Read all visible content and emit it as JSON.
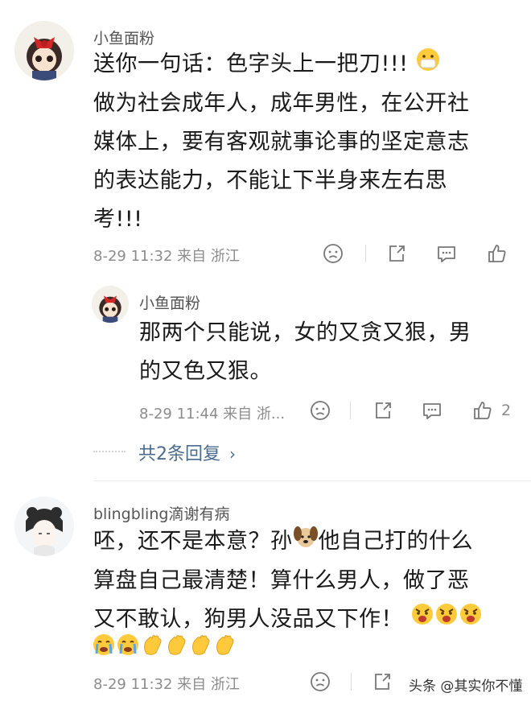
{
  "comments": [
    {
      "username": "小鱼面粉",
      "lines": [
        "送你一句话：色字头上一把刀!!!",
        "做为社会成年人，成年男性，在公开社",
        "媒体上，要有客观就事论事的坚定意志",
        "的表达能力，不能让下半身来左右思",
        "考!!!"
      ],
      "meta": "8-29 11:32 来自 浙江",
      "reply": {
        "username": "小鱼面粉",
        "lines": [
          "那两个只能说，女的又贪又狠，男",
          "的又色又狠。"
        ],
        "meta": "8-29 11:44 来自 浙...",
        "like_count": "2"
      },
      "more_replies": "共2条回复"
    },
    {
      "username": "blingbling滴谢有病",
      "lines": [
        "呸，还不是本意？孙",
        "他自己打的什么",
        "算盘自己最清楚！算什么男人，做了恶",
        "又不敢认，狗男人没品又下作！"
      ],
      "meta": "8-29 11:32 来自 浙江"
    }
  ],
  "watermark": "头条 @其实你不懂",
  "icons": {
    "emoji_mask": "mask-emoji-icon",
    "emoji_dog": "dog-emoji-icon",
    "emoji_angry": "angry-emoji-icon",
    "emoji_crying": "crying-emoji-icon",
    "emoji_clap": "clap-emoji-icon",
    "dislike": "frown-face-icon",
    "share": "share-icon",
    "comment": "comment-bubble-icon",
    "like": "thumbs-up-icon"
  },
  "colors": {
    "link": "#4a6b8c",
    "meta": "#8c8c8c"
  }
}
